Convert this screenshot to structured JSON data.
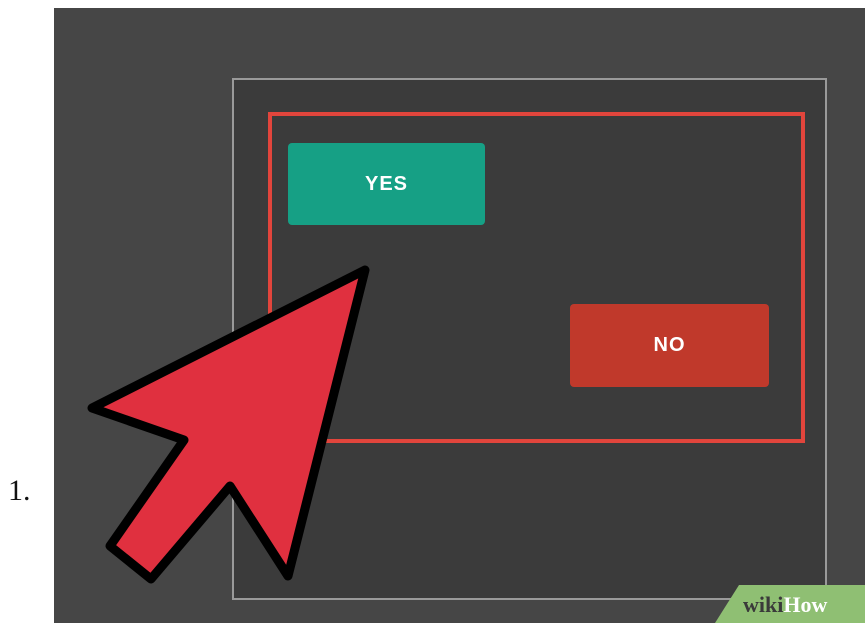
{
  "list": {
    "number": "1."
  },
  "dialog": {
    "yes_label": "YES",
    "no_label": "NO"
  },
  "watermark": {
    "wiki": "wiki",
    "how": "How"
  },
  "icons": {
    "pointer": "arrow-cursor-icon"
  },
  "colors": {
    "background": "#464646",
    "screen": "#3b3b3b",
    "frame": "#9a9a9a",
    "dialog_border": "#e2453c",
    "yes_button": "#16a085",
    "no_button": "#c0392b",
    "cursor_fill": "#e0303f",
    "cursor_outline": "#000000",
    "watermark_band": "#8fbf73"
  }
}
